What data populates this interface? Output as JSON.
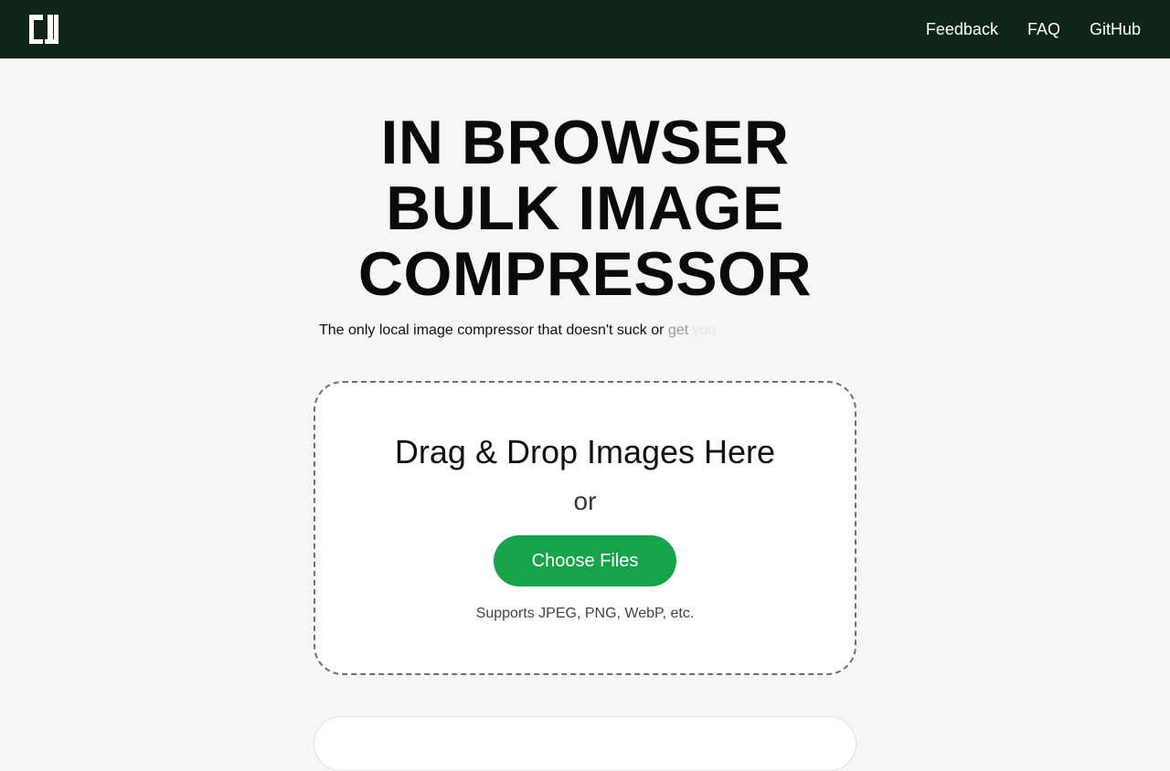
{
  "header": {
    "logo_icon": "app-logo-icon",
    "background": "#0e2618",
    "nav": [
      {
        "label": "Feedback"
      },
      {
        "label": "FAQ"
      },
      {
        "label": "GitHub"
      }
    ]
  },
  "hero": {
    "title_lines": [
      "IN BROWSER",
      "BULK IMAGE",
      "COMPRESSOR"
    ],
    "tagline_main": "The only local image compressor that doesn't suck or",
    "tagline_faded_1": "get",
    "tagline_faded_2": "you"
  },
  "dropzone": {
    "title": "Drag & Drop Images Here",
    "or": "or",
    "button_label": "Choose Files",
    "button_color": "#16a34a",
    "support_text": "Supports JPEG, PNG, WebP, etc."
  }
}
